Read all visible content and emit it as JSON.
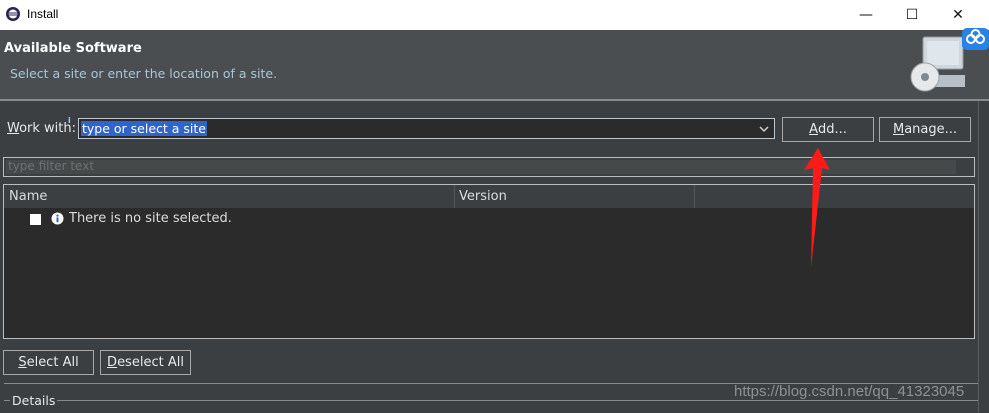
{
  "window": {
    "title": "Install",
    "minimize_glyph": "—",
    "maximize_glyph": "☐",
    "close_glyph": "✕"
  },
  "header": {
    "title": "Available Software",
    "subtitle": "Select a site or enter the location of a site."
  },
  "work_with": {
    "label_accel": "W",
    "label_rest": "ork with:",
    "info_marker": "i",
    "combo_value": "type or select a site",
    "add_label_accel": "A",
    "add_label_rest": "dd...",
    "manage_label_accel": "M",
    "manage_label_rest": "anage..."
  },
  "filter": {
    "placeholder": "type filter text"
  },
  "table": {
    "columns": [
      "Name",
      "Version"
    ],
    "rows": [
      {
        "checked": false,
        "icon": "info-icon",
        "text": "There is no site selected."
      }
    ]
  },
  "buttons": {
    "select_all_accel": "S",
    "select_all_rest": "elect All",
    "deselect_all_accel": "D",
    "deselect_all_rest": "eselect All"
  },
  "details": {
    "label": "Details"
  },
  "watermark": "https://blog.csdn.net/qq_41323045",
  "colors": {
    "background": "#3c3f41",
    "selection": "#2f65ca",
    "annotation_arrow": "#ff1a1a"
  }
}
